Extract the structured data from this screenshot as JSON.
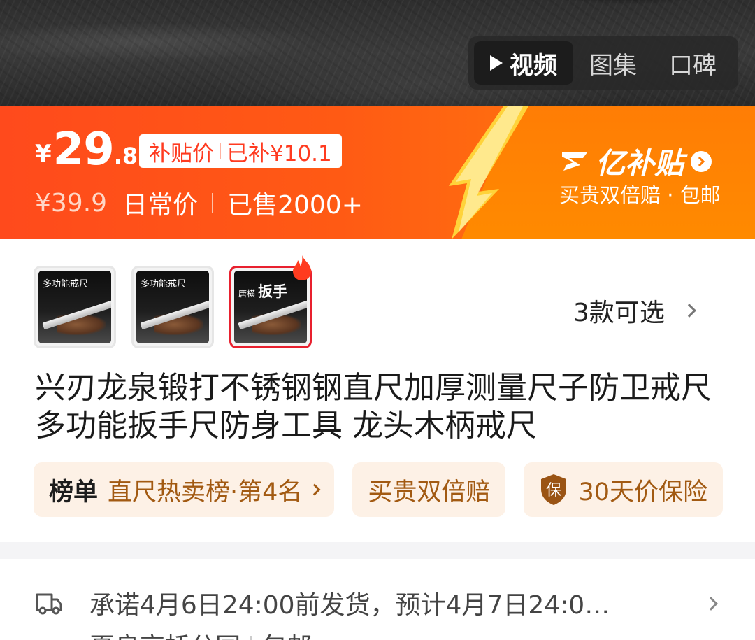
{
  "media_tabs": [
    "视频",
    "图集",
    "口碑"
  ],
  "price": {
    "currency": "¥",
    "integer": "29",
    "decimal": ".8",
    "subsidy_label": "补贴价",
    "subsidy_amount": "已补¥10.1",
    "original_price": "¥39.9",
    "original_label": "日常价",
    "sold": "已售2000+"
  },
  "brand": {
    "name": "亿补贴",
    "subtitle": "买贵双倍赔 · 包邮"
  },
  "variants": {
    "thumbs": [
      {
        "text": "多功能戒尺",
        "selected": false
      },
      {
        "text": "多功能戒尺",
        "selected": false
      },
      {
        "text_small": "唐横",
        "text_big": "扳手",
        "selected": true
      }
    ],
    "count_label": "3款可选"
  },
  "title": "兴刃龙泉锻打不锈钢钢直尺加厚测量尺子防卫戒尺多功能扳手尺防身工具 龙头木柄戒尺",
  "tags": {
    "rank_label": "榜单",
    "rank_value": "直尺热卖榜·第4名",
    "guarantee": "买贵双倍赔",
    "protect_icon_text": "保",
    "protect_label": "30天价保险"
  },
  "delivery": {
    "line1": "承诺4月6日24:00前发货，预计4月7日24:0…",
    "from": "夏良高桥分园",
    "shipping": "包邮"
  },
  "colors": {
    "banner_red": "#ff4a1c",
    "banner_orange": "#ff8a00",
    "tag_bg": "#fdf1e6",
    "tag_text": "#a25a12",
    "selected_border": "#e8202e"
  }
}
